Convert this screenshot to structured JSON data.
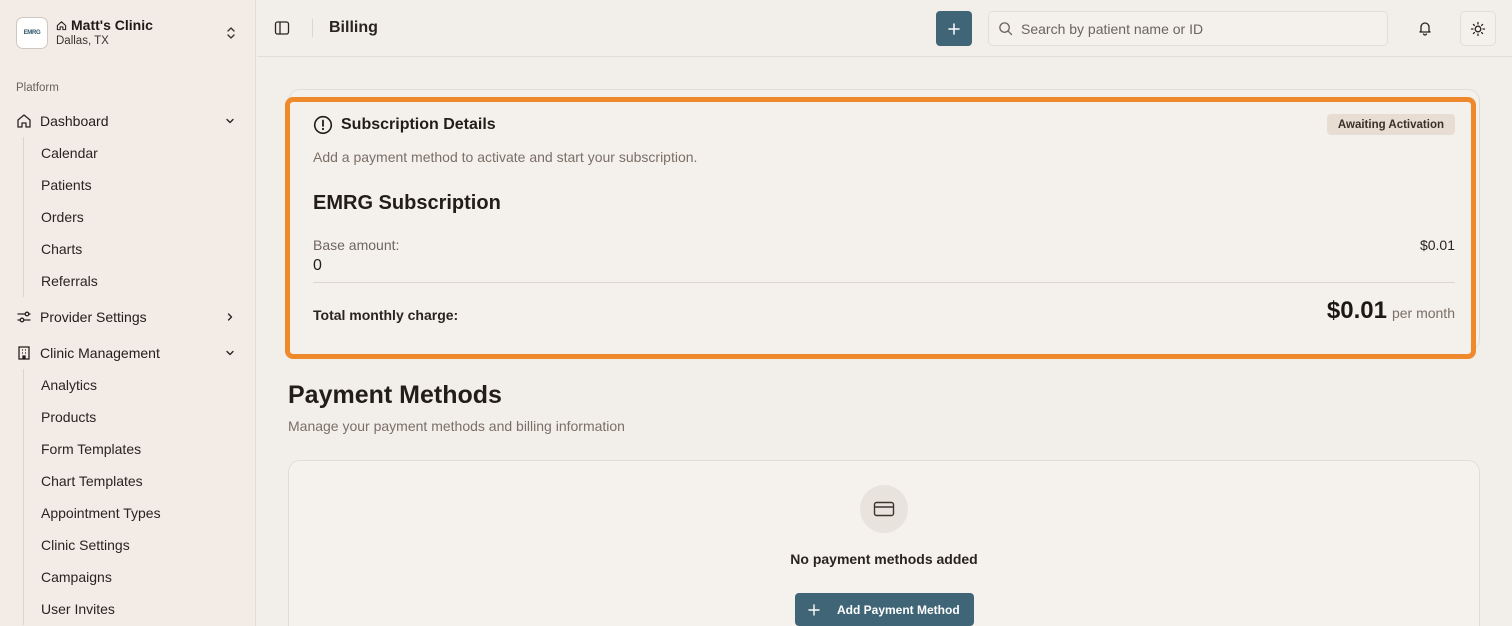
{
  "clinic": {
    "logo_text": "EMRG",
    "name": "Matt's Clinic",
    "location": "Dallas, TX"
  },
  "sidebar": {
    "section_label": "Platform",
    "dashboard": {
      "label": "Dashboard",
      "items": [
        "Calendar",
        "Patients",
        "Orders",
        "Charts",
        "Referrals"
      ]
    },
    "provider_settings": {
      "label": "Provider Settings"
    },
    "clinic_management": {
      "label": "Clinic Management",
      "items": [
        "Analytics",
        "Products",
        "Form Templates",
        "Chart Templates",
        "Appointment Types",
        "Clinic Settings",
        "Campaigns",
        "User Invites"
      ]
    }
  },
  "header": {
    "title": "Billing",
    "search_placeholder": "Search by patient name or ID"
  },
  "subscription": {
    "title": "Subscription Details",
    "status": "Awaiting Activation",
    "description": "Add a payment method to activate and start your subscription.",
    "plan_name": "EMRG Subscription",
    "base_label": "Base amount:",
    "base_value": "0",
    "base_amount": "$0.01",
    "total_label": "Total monthly charge:",
    "total_amount": "$0.01",
    "total_period": "per month"
  },
  "payment_methods": {
    "title": "Payment Methods",
    "description": "Manage your payment methods and billing information",
    "empty_text": "No payment methods added",
    "add_label": "Add Payment Method"
  },
  "colors": {
    "accent": "#3f6577",
    "highlight": "#ee8a2b",
    "sidebar_bg": "#f3ebe6",
    "page_bg": "#f2efea"
  }
}
